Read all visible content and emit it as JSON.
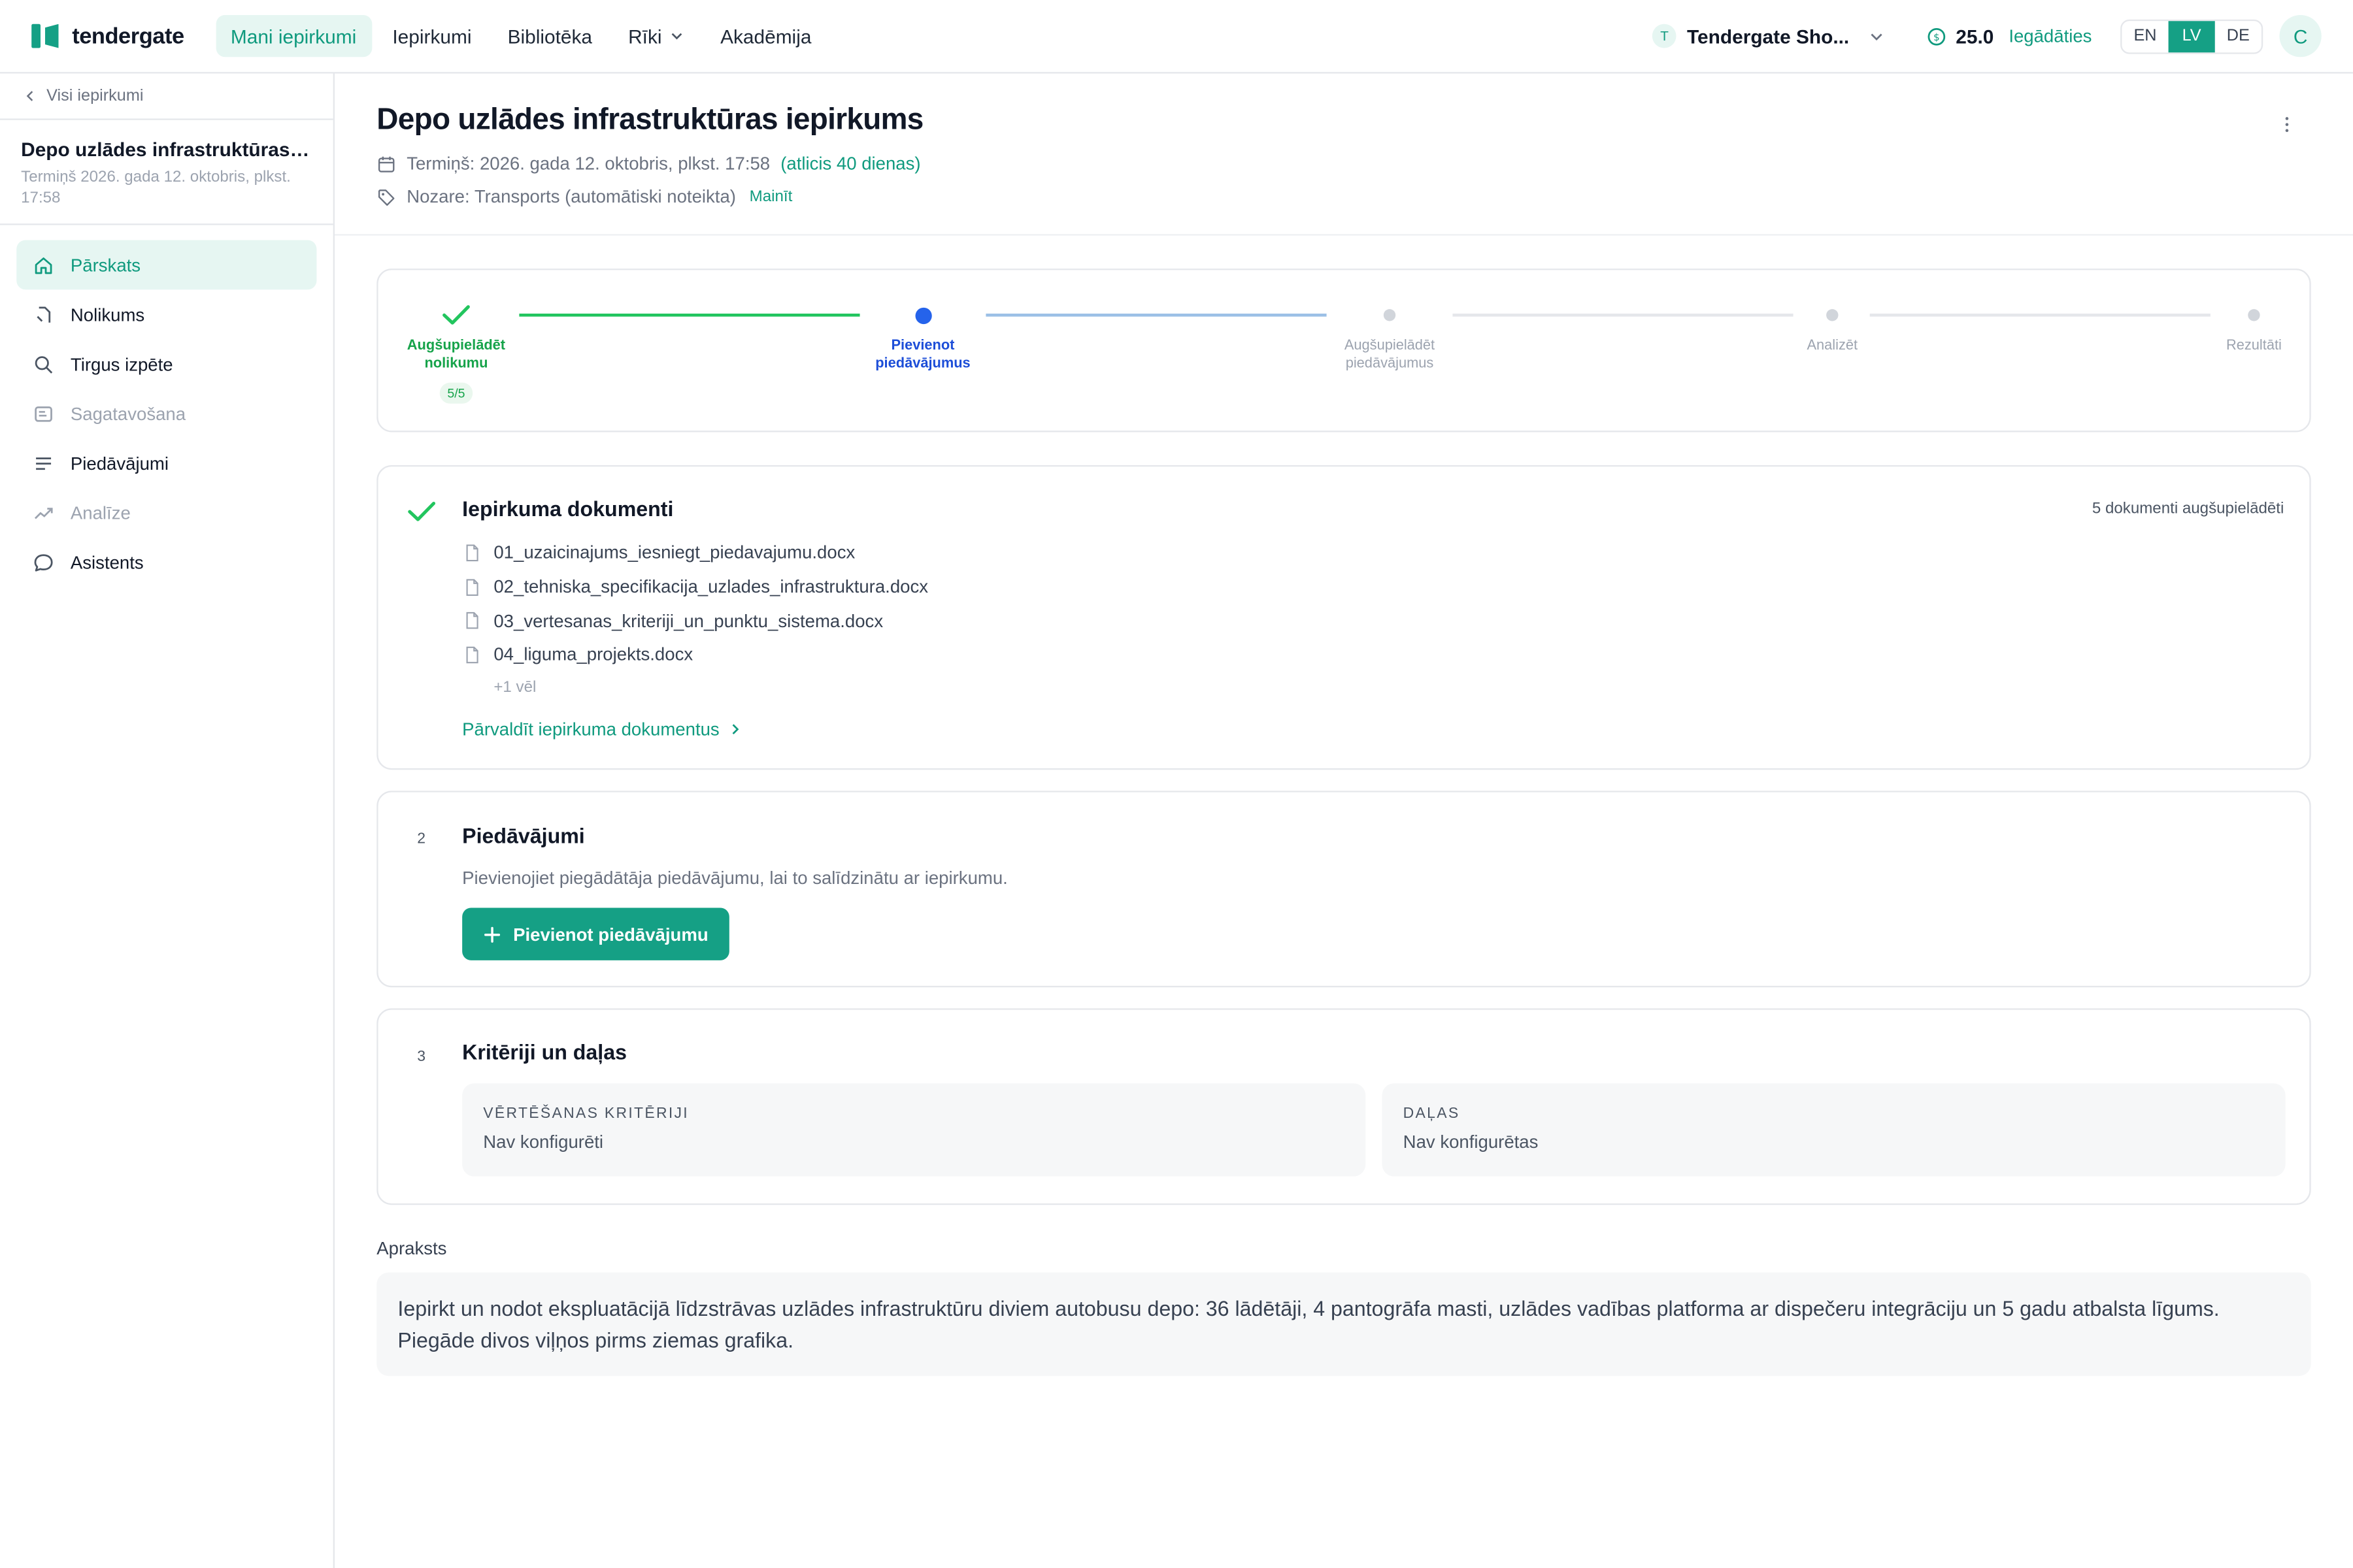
{
  "brand": {
    "name": "tendergate"
  },
  "nav": [
    {
      "label": "Mani iepirkumi",
      "active": true
    },
    {
      "label": "Iepirkumi",
      "active": false
    },
    {
      "label": "Bibliotēka",
      "active": false
    },
    {
      "label": "Rīki",
      "active": false,
      "dropdown": true
    },
    {
      "label": "Akadēmija",
      "active": false
    }
  ],
  "org": {
    "badge": "T",
    "name": "Tendergate Sho..."
  },
  "credits": {
    "amount": "25.0",
    "buy_label": "Iegādāties"
  },
  "languages": [
    {
      "code": "EN",
      "active": false
    },
    {
      "code": "LV",
      "active": true
    },
    {
      "code": "DE",
      "active": false
    }
  ],
  "user": {
    "initial": "C"
  },
  "sidebar": {
    "back_label": "Visi iepirkumi",
    "project_title": "Depo uzlādes infrastruktūras i...",
    "project_deadline": "Termiņš 2026. gada 12. oktobris, plkst. 17:58",
    "items": [
      {
        "label": "Pārskats",
        "icon": "home-icon",
        "active": true,
        "muted": false
      },
      {
        "label": "Nolikums",
        "icon": "document-icon",
        "active": false,
        "muted": false
      },
      {
        "label": "Tirgus izpēte",
        "icon": "search-icon",
        "active": false,
        "muted": false
      },
      {
        "label": "Sagatavošana",
        "icon": "list-box-icon",
        "active": false,
        "muted": true
      },
      {
        "label": "Piedāvājumi",
        "icon": "lines-icon",
        "active": false,
        "muted": false
      },
      {
        "label": "Analīze",
        "icon": "trend-icon",
        "active": false,
        "muted": true
      },
      {
        "label": "Asistents",
        "icon": "chat-icon",
        "active": false,
        "muted": false
      }
    ]
  },
  "page": {
    "title": "Depo uzlādes infrastruktūras iepirkums",
    "deadline": "Termiņš: 2026. gada 12. oktobris, plkst. 17:58",
    "remaining": "(atlicis 40 dienas)",
    "sector": "Nozare: Transports (automātiski noteikta)",
    "change_label": "Mainīt"
  },
  "stepper": {
    "steps": [
      {
        "label_line1": "Augšupielādēt",
        "label_line2": "nolikumu",
        "state": "done",
        "count": "5/5"
      },
      {
        "label_line1": "Pievienot",
        "label_line2": "piedāvājumus",
        "state": "current"
      },
      {
        "label_line1": "Augšupielādēt",
        "label_line2": "piedāvājumus",
        "state": "pending"
      },
      {
        "label_line1": "Analizēt",
        "label_line2": "",
        "state": "pending"
      },
      {
        "label_line1": "Rezultāti",
        "label_line2": "",
        "state": "pending"
      }
    ]
  },
  "documents": {
    "title": "Iepirkuma dokumenti",
    "count_label": "5 dokumenti augšupielādēti",
    "files": [
      "01_uzaicinajums_iesniegt_piedavajumu.docx",
      "02_tehniska_specifikacija_uzlades_infrastruktura.docx",
      "03_vertesanas_kriteriji_un_punktu_sistema.docx",
      "04_liguma_projekts.docx"
    ],
    "more_label": "+1 vēl",
    "manage_label": "Pārvaldīt iepirkuma dokumentus"
  },
  "offers": {
    "number": "2",
    "title": "Piedāvājumi",
    "description": "Pievienojiet piegādātāja piedāvājumu, lai to salīdzinātu ar iepirkumu.",
    "button_label": "Pievienot piedāvājumu"
  },
  "criteria": {
    "number": "3",
    "title": "Kritēriji un daļas",
    "boxes": [
      {
        "key": "Vērtēšanas kritēriji",
        "value": "Nav konfigurēti"
      },
      {
        "key": "Daļas",
        "value": "Nav konfigurētas"
      }
    ]
  },
  "description": {
    "label": "Apraksts",
    "text": "Iepirkt un nodot ekspluatācijā līdzstrāvas uzlādes infrastruktūru diviem autobusu depo: 36 lādētāji, 4 pantogrāfa masti, uzlādes vadības platforma ar dispečeru integrāciju un 5 gadu atbalsta līgums. Piegāde divos viļņos pirms ziemas grafika."
  },
  "colors": {
    "accent": "#15a085",
    "accent_text": "#0f9a7e",
    "current_step": "#2563eb",
    "done_step": "#16a34a"
  }
}
